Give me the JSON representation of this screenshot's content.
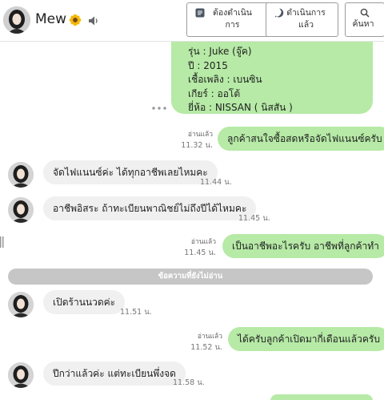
{
  "header": {
    "contact_name": "Mew",
    "buttons": [
      {
        "icon": "list-icon",
        "label_line1": "ต้องดำเนิน",
        "label_line2": "การ"
      },
      {
        "icon": "chat-check-icon",
        "label_line1": "ดำเนินการ",
        "label_line2": "แล้ว"
      },
      {
        "icon": "search-icon",
        "label_line1": "",
        "label_line2": "ค้นหา"
      }
    ]
  },
  "messages": {
    "car_details": {
      "model": "รุ่น : Juke (จู๊ค)",
      "year": "ปี : 2015",
      "fuel": "เชื้อเพลิง : เบนซิน",
      "gear": "เกียร์ : ออโต้",
      "brand": "ยี่ห้อ : NISSAN ( นิสสัน )"
    },
    "m1": {
      "text": "ลูกค้าสนใจซื้อสดหรือจัดไฟแนนซ์ครับ",
      "read": "อ่านแล้ว",
      "time": "11.32 น."
    },
    "m2": {
      "text": "จัดไฟแนนซ์ค่ะ ได้ทุกอาชีพเลยไหมคะ",
      "time": "11.44 น."
    },
    "m3": {
      "text": "อาชีพอิสระ ถ้าทะเบียนพาณิชย์ไม่ถึงปีได้ไหมคะ",
      "time": "11.45 น."
    },
    "m4": {
      "text": "เป็นอาชีพอะไรครับ อาชีพที่ลูกค้าทำ",
      "read": "อ่านแล้ว",
      "time": "11.45 น."
    },
    "unread_divider": "ข้อความที่ยังไม่อ่าน",
    "m5": {
      "text": "เปิดร้านนวดค่ะ",
      "time": "11.51 น."
    },
    "m6": {
      "text": "ได้ครับลูกค้าเปิดมากี่เดือนแล้วครับ",
      "read": "อ่านแล้ว",
      "time": "11.52 น."
    },
    "m7": {
      "text": "ปีกว่าแล้วค่ะ แต่ทะเบียนพึ่งจด",
      "time": "11.58 น."
    }
  },
  "colors": {
    "outgoing_bubble": "#b6eaa6",
    "incoming_bubble": "#f0f0f0",
    "unread_bar": "#c6c6c6"
  }
}
